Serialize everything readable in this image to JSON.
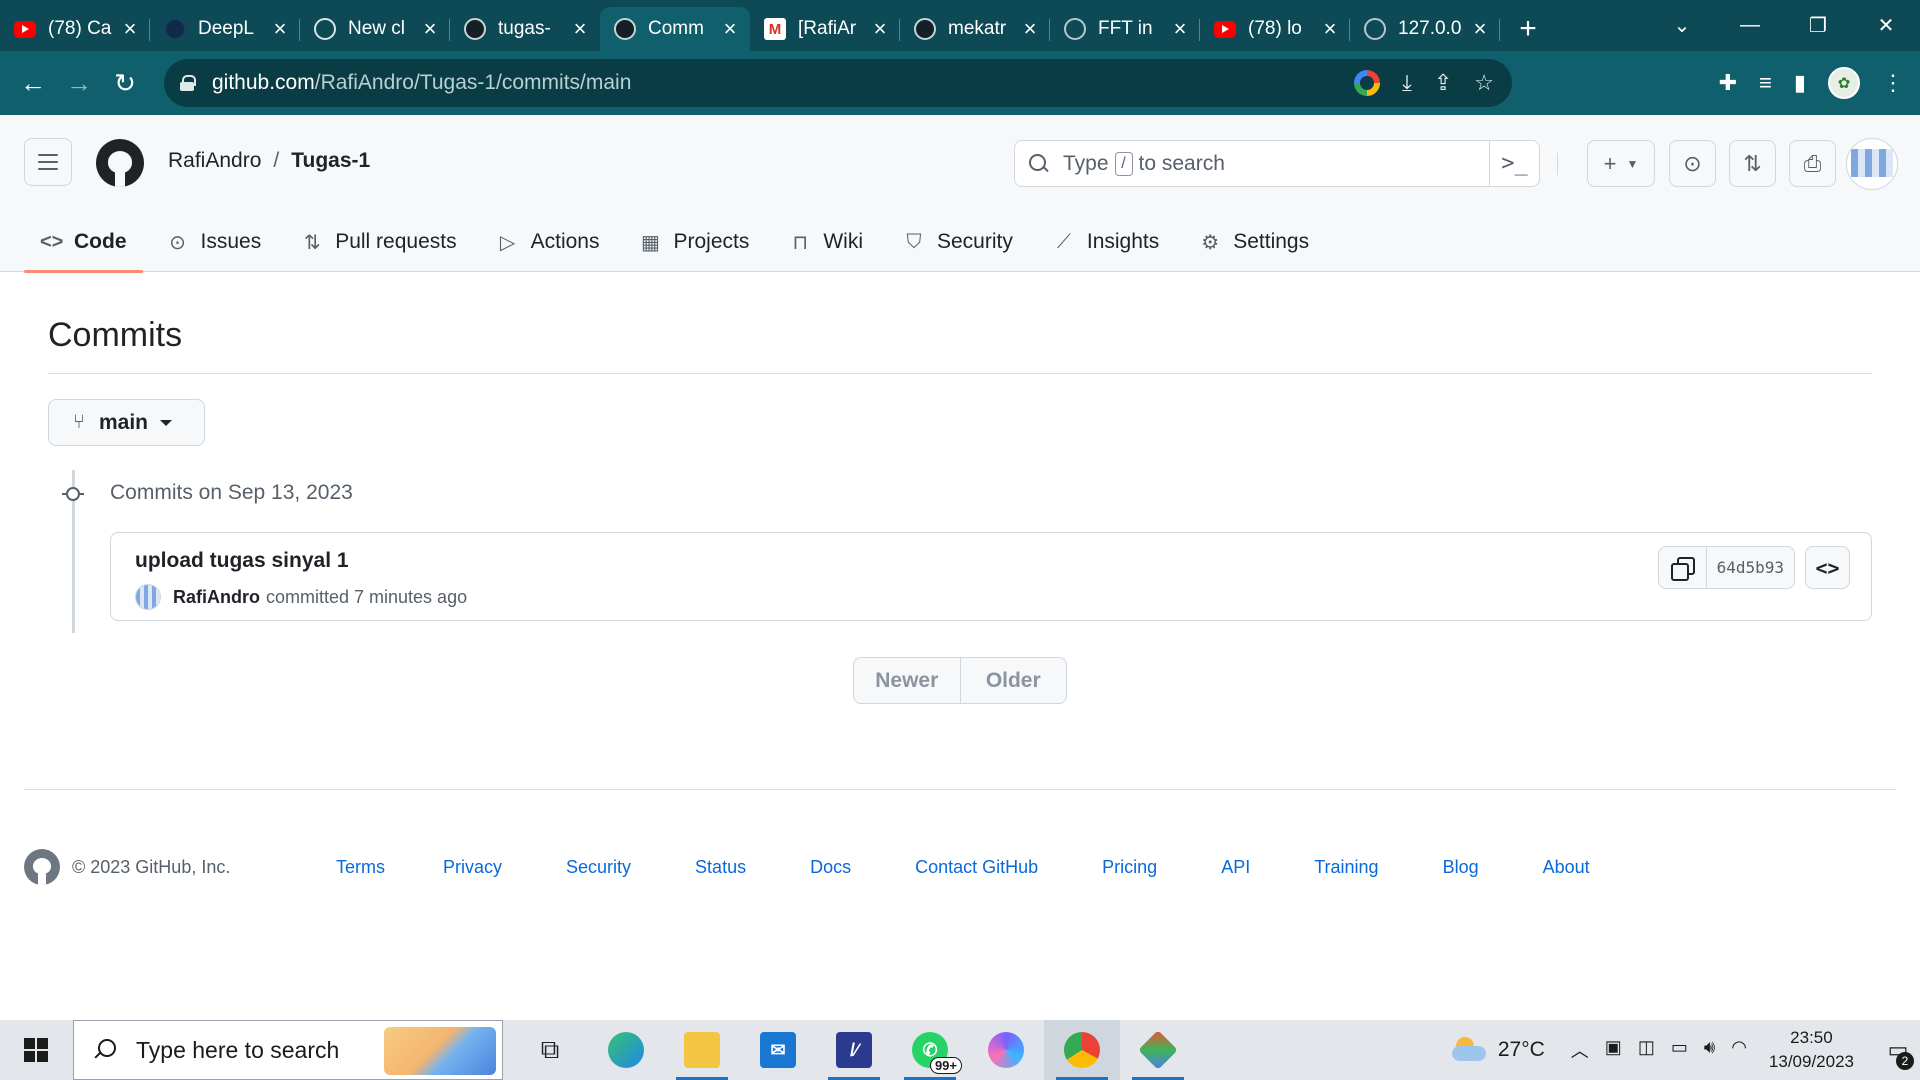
{
  "browser": {
    "tabs": [
      {
        "title": "(78) Ca",
        "icon": "youtube-icon"
      },
      {
        "title": "DeepL",
        "icon": "deepl-icon"
      },
      {
        "title": "New cl",
        "icon": "chatgpt-icon"
      },
      {
        "title": "tugas-",
        "icon": "github-icon"
      },
      {
        "title": "Comm",
        "icon": "github-icon"
      },
      {
        "title": "[RafiAr",
        "icon": "gmail-icon"
      },
      {
        "title": "mekatr",
        "icon": "github-icon"
      },
      {
        "title": "FFT in",
        "icon": "globe-icon"
      },
      {
        "title": "(78) lo",
        "icon": "youtube-icon"
      },
      {
        "title": "127.0.0",
        "icon": "globe-icon"
      }
    ],
    "active_tab_index": 4,
    "url_host": "github.com",
    "url_path": "/RafiAndro/Tugas-1/commits/main",
    "colors": {
      "chrome": "#0d4a55",
      "toolbar": "#0f5f6d"
    }
  },
  "github": {
    "owner": "RafiAndro",
    "path_separator": "/",
    "repo": "Tugas-1",
    "search": {
      "prefix": "Type",
      "key": "/",
      "suffix": "to search"
    },
    "tabs": [
      {
        "label": "Code",
        "icon": "code-icon",
        "active": true
      },
      {
        "label": "Issues",
        "icon": "issue-icon"
      },
      {
        "label": "Pull requests",
        "icon": "pull-request-icon"
      },
      {
        "label": "Actions",
        "icon": "play-icon"
      },
      {
        "label": "Projects",
        "icon": "table-icon"
      },
      {
        "label": "Wiki",
        "icon": "book-icon"
      },
      {
        "label": "Security",
        "icon": "shield-icon"
      },
      {
        "label": "Insights",
        "icon": "graph-icon"
      },
      {
        "label": "Settings",
        "icon": "gear-icon"
      }
    ],
    "accent": "#fd8c73"
  },
  "page": {
    "title": "Commits",
    "branch": "main",
    "group_heading": "Commits on Sep 13, 2023",
    "commit": {
      "message": "upload tugas sinyal 1",
      "author": "RafiAndro",
      "meta": "committed 7 minutes ago",
      "sha": "64d5b93"
    },
    "pager": {
      "newer": "Newer",
      "older": "Older"
    }
  },
  "footer": {
    "copyright": "© 2023 GitHub, Inc.",
    "links": [
      "Terms",
      "Privacy",
      "Security",
      "Status",
      "Docs",
      "Contact GitHub",
      "Pricing",
      "API",
      "Training",
      "Blog",
      "About"
    ],
    "link_color": "#0969da"
  },
  "taskbar": {
    "search_placeholder": "Type here to search",
    "whatsapp_badge": "99+",
    "temperature": "27°C",
    "time": "23:50",
    "date": "13/09/2023",
    "notifications": "2"
  }
}
